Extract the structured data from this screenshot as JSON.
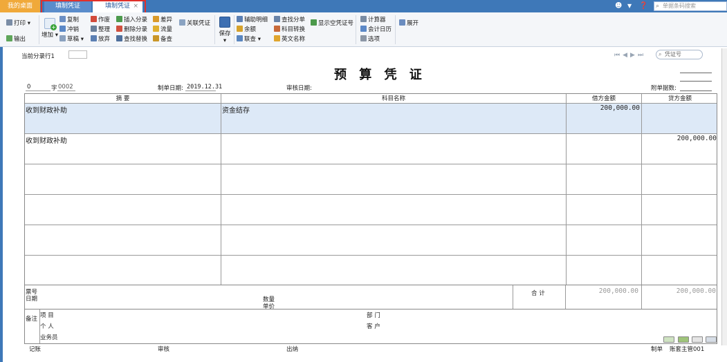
{
  "tabs": {
    "home": "我的桌面",
    "tab1": "填制凭证",
    "tab2": "填制凭证",
    "close": "×"
  },
  "topbar": {
    "search_placeholder": "单据条码搜索"
  },
  "toolbar": {
    "print": "打印",
    "export": "输出",
    "add": "增加",
    "copy": "复制",
    "reverse": "冲销",
    "draft": "草稿",
    "void": "作废",
    "tidy": "整理",
    "discard": "放弃",
    "insert_entry": "插入分录",
    "delete_entry": "删除分录",
    "find_replace": "查找替换",
    "variance": "差异",
    "cashflow": "流量",
    "memo": "备查",
    "link_voucher": "关联凭证",
    "save": "保存",
    "aux_detail": "辅助明细",
    "balance": "余额",
    "joint_query": "联查",
    "find_entry": "查找分单",
    "account_convert": "科目转换",
    "english_name": "英文名称",
    "show_empty_voucher": "显示空凭证号",
    "calculator": "计算器",
    "accounting_calendar": "会计日历",
    "options": "选项",
    "expand": "展开"
  },
  "header": {
    "current_entry_row": "当前分录行1",
    "voucher_search_placeholder": "凭证号",
    "title": "预 算 凭 证",
    "voucher_prefix": "0",
    "voucher_word_label": "字",
    "voucher_no": "0002",
    "date_label": "制单日期:",
    "date_value": "2019.12.31",
    "audit_date_label": "审核日期:",
    "attachment_label": "附单据数:"
  },
  "grid": {
    "headers": {
      "summary": "摘 要",
      "account": "科目名称",
      "debit": "借方金额",
      "credit": "贷方金额"
    },
    "rows": [
      {
        "summary": "收到财政补助",
        "account": "资金结存",
        "debit": "200,000.00",
        "credit": ""
      },
      {
        "summary": "收到财政补助",
        "account": "",
        "debit": "",
        "credit": "200,000.00"
      }
    ]
  },
  "footer": {
    "ticket_no": "票号",
    "date": "日期",
    "quantity": "数量",
    "unit_price": "单价",
    "total_label": "合 计",
    "total_debit": "200,000.00",
    "total_credit": "200,000.00",
    "remark": "备注",
    "project": "项 目",
    "department": "部 门",
    "person": "个 人",
    "customer": "客 户",
    "salesman": "业务员"
  },
  "signoff": {
    "bookkeeping": "记账",
    "audit": "审核",
    "cashier": "出纳",
    "preparer_label": "制单",
    "preparer": "账套主管001"
  }
}
